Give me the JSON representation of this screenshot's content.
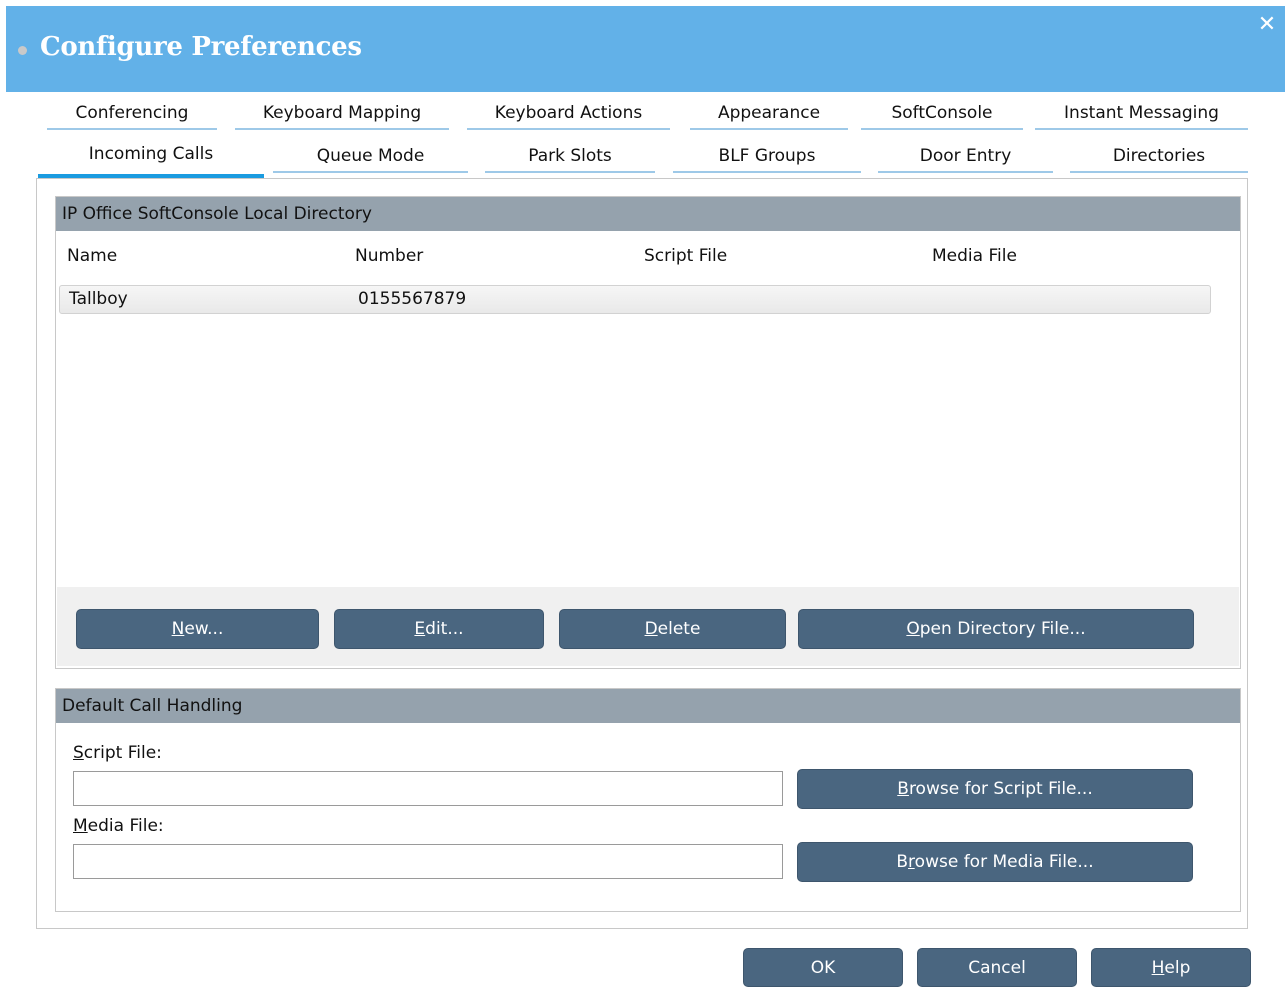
{
  "window": {
    "title": "Configure Preferences",
    "close_icon": "close-icon",
    "accent": "#62b1e8"
  },
  "tabs_row1": [
    {
      "label": "Conferencing"
    },
    {
      "label": "Keyboard Mapping"
    },
    {
      "label": "Keyboard Actions"
    },
    {
      "label": "Appearance"
    },
    {
      "label": "SoftConsole"
    },
    {
      "label": "Instant Messaging"
    }
  ],
  "tabs_row2": [
    {
      "label": "Incoming Calls",
      "active": true
    },
    {
      "label": "Queue Mode"
    },
    {
      "label": "Park Slots"
    },
    {
      "label": "BLF Groups"
    },
    {
      "label": "Door Entry"
    },
    {
      "label": "Directories"
    }
  ],
  "directory": {
    "header": "IP Office SoftConsole Local Directory",
    "columns": [
      "Name",
      "Number",
      "Script File",
      "Media File"
    ],
    "rows": [
      {
        "name": "Tallboy",
        "number": "0155567879",
        "script_file": "",
        "media_file": ""
      }
    ],
    "buttons": {
      "new": {
        "mnemonic": "N",
        "rest": "ew..."
      },
      "edit": {
        "mnemonic": "E",
        "rest": "dit..."
      },
      "delete": {
        "mnemonic": "D",
        "rest": "elete"
      },
      "open": {
        "mnemonic": "O",
        "rest": "pen Directory File..."
      }
    }
  },
  "call_handling": {
    "header": "Default Call Handling",
    "script_label": {
      "mnemonic": "S",
      "rest": "cript File:"
    },
    "script_value": "",
    "media_label": {
      "mnemonic": "M",
      "rest": "edia File:"
    },
    "media_value": "",
    "browse_script": {
      "pre": "",
      "mnemonic": "B",
      "rest": "rowse for Script File..."
    },
    "browse_media": {
      "pre": "B",
      "mnemonic": "r",
      "rest": "owse for Media File..."
    }
  },
  "footer": {
    "ok": "OK",
    "cancel": "Cancel",
    "help": {
      "mnemonic": "H",
      "rest": "elp"
    }
  }
}
